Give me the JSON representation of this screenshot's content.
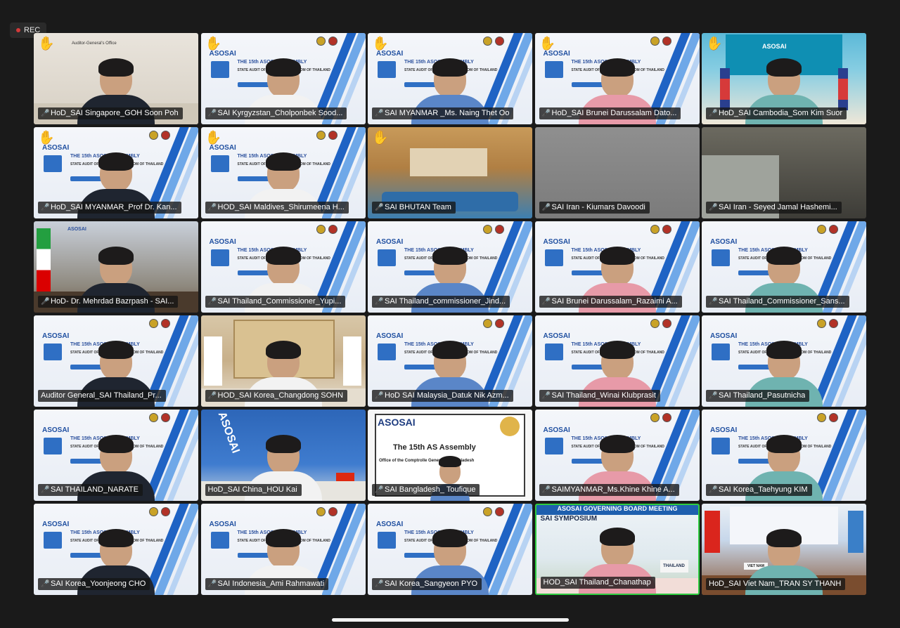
{
  "recording": {
    "label": "REC"
  },
  "colors": {
    "background": "#1a1a1a",
    "active_speaker_border": "#2ecc40",
    "muted_mic": "#ff4d4d",
    "asosai_blue": "#1f63c4"
  },
  "participants": [
    {
      "name": "HoD_SAI Singapore_GOH Soon Poh",
      "hand_raised": true,
      "muted": true,
      "scene": "office",
      "screen_text": "Auditor-General's Office"
    },
    {
      "name": "SAI Kyrgyzstan_Cholponbek Sood...",
      "hand_raised": true,
      "muted": true,
      "scene": "asosai"
    },
    {
      "name": "SAI MYANMAR _Ms. Naing Thet Oo",
      "hand_raised": true,
      "muted": true,
      "scene": "asosai"
    },
    {
      "name": "HoD_SAI Brunei Darussalam Dato...",
      "hand_raised": true,
      "muted": true,
      "scene": "asosai"
    },
    {
      "name": "HoD_SAI Cambodia_Som Kim Suor",
      "hand_raised": true,
      "muted": true,
      "scene": "cambodia",
      "screen_text": "ASOSAI"
    },
    {
      "name": "HoD_SAI MYANMAR_Prof Dr. Kan...",
      "hand_raised": true,
      "muted": true,
      "scene": "asosai"
    },
    {
      "name": "HOD_SAI Maldives_Shirumeena H...",
      "hand_raised": true,
      "muted": true,
      "scene": "asosai"
    },
    {
      "name": "SAI BHUTAN Team",
      "hand_raised": true,
      "muted": true,
      "scene": "hall"
    },
    {
      "name": "SAI Iran - Kiumars Davoodi",
      "hand_raised": false,
      "muted": true,
      "scene": "grey"
    },
    {
      "name": "SAI Iran - Seyed Jamal Hashemi...",
      "hand_raised": false,
      "muted": true,
      "scene": "room"
    },
    {
      "name": "HoD- Dr. Mehrdad Bazrpash - SAI...",
      "hand_raised": false,
      "muted": true,
      "scene": "iran",
      "screen_text": "ASOSAI"
    },
    {
      "name": "SAI Thailand_Commissioner_Yupi...",
      "hand_raised": false,
      "muted": true,
      "scene": "asosai"
    },
    {
      "name": "SAI Thailand_commissioner_Jind...",
      "hand_raised": false,
      "muted": true,
      "scene": "asosai"
    },
    {
      "name": "SAI Brunei Darussalam_Razaimi A...",
      "hand_raised": false,
      "muted": true,
      "scene": "asosai"
    },
    {
      "name": "SAI Thailand_Commissioner_Sans...",
      "hand_raised": false,
      "muted": true,
      "scene": "asosai"
    },
    {
      "name": "Auditor General_SAI Thailand_Pr...",
      "hand_raised": false,
      "muted": false,
      "scene": "asosai"
    },
    {
      "name": "HOD_SAI Korea_Changdong SOHN",
      "hand_raised": false,
      "muted": true,
      "scene": "korea"
    },
    {
      "name": "HoD SAI Malaysia_Datuk Nik Azm...",
      "hand_raised": false,
      "muted": true,
      "scene": "asosai"
    },
    {
      "name": "SAI Thailand_Winai Klubprasit",
      "hand_raised": false,
      "muted": true,
      "scene": "asosai"
    },
    {
      "name": "SAI Thailand_Pasutnicha",
      "hand_raised": false,
      "muted": true,
      "scene": "asosai"
    },
    {
      "name": "SAI THAILAND_NARATE",
      "hand_raised": false,
      "muted": true,
      "scene": "asosai"
    },
    {
      "name": "HoD_SAI China_HOU Kai",
      "hand_raised": false,
      "muted": false,
      "scene": "china",
      "screen_text": "ASOSAI"
    },
    {
      "name": "SAI Bangladesh_ Toufique",
      "hand_raised": false,
      "muted": true,
      "scene": "bangla",
      "screen_text": "ASOSAI"
    },
    {
      "name": "SAIMYANMAR_Ms.Khine Khine A...",
      "hand_raised": false,
      "muted": true,
      "scene": "asosai"
    },
    {
      "name": "SAI Korea_Taehyung KIM",
      "hand_raised": false,
      "muted": true,
      "scene": "asosai"
    },
    {
      "name": "SAI Korea_Yoonjeong CHO",
      "hand_raised": false,
      "muted": true,
      "scene": "asosai"
    },
    {
      "name": "SAI Indonesia_Ami Rahmawati",
      "hand_raised": false,
      "muted": true,
      "scene": "asosai"
    },
    {
      "name": "SAI Korea_Sangyeon PYO",
      "hand_raised": false,
      "muted": true,
      "scene": "asosai"
    },
    {
      "name": "HOD_SAI Thailand_Chanathap",
      "hand_raised": false,
      "muted": false,
      "scene": "governing",
      "active_speaker": true,
      "screen_text": "ASOSAI GOVERNING BOARD MEETING"
    },
    {
      "name": "HoD_SAI Viet Nam_TRAN SY THANH",
      "hand_raised": false,
      "muted": false,
      "scene": "vietnam",
      "screen_text": "VIET NAM"
    }
  ],
  "background_text": {
    "asosai_logo": "ASOSAI",
    "assembly_title": "THE 15th ASOSAI ASSEMBLY",
    "assembly_sub": "STATE AUDIT OFFICE OF THE KINGDOM OF THAILAND",
    "bangladesh_title": "The 15th AS   Assembly",
    "bangladesh_sub": "Office of the Comptrolle        General of Bangladesh",
    "governing_line2": "SAI SYMPOSIUM",
    "thailand_plate": "THAILAND"
  }
}
